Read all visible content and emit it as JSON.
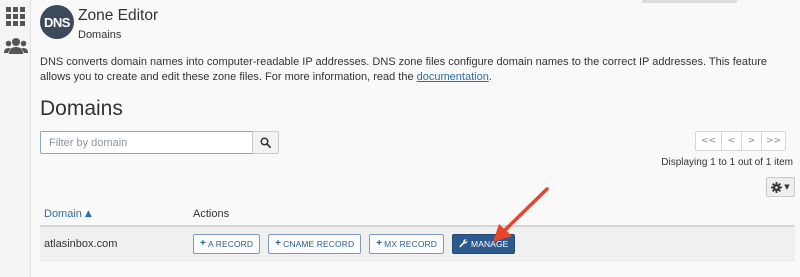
{
  "app": {
    "logo_text": "DNS",
    "title": "Zone Editor",
    "breadcrumb": "Domains"
  },
  "intro": {
    "text": "DNS converts domain names into computer-readable IP addresses. DNS zone files configure domain names to the correct IP addresses. This feature allows you to create and edit these zone files. For more information, read the ",
    "link_label": "documentation",
    "trailing": "."
  },
  "section": {
    "title": "Domains"
  },
  "filter": {
    "placeholder": "Filter by domain",
    "value": ""
  },
  "pager": {
    "first": "<<",
    "prev": "<",
    "next": ">",
    "last": ">>"
  },
  "paging_info": "Displaying 1 to 1 out of 1 item",
  "table": {
    "col_domain": "Domain",
    "col_actions": "Actions",
    "rows": [
      {
        "domain": "atlasinbox.com",
        "a_record": "A RECORD",
        "cname_record": "CNAME RECORD",
        "mx_record": "MX RECORD",
        "manage": "MANAGE"
      }
    ]
  },
  "icons": {
    "rail": [
      "apps-grid-icon",
      "users-icon"
    ],
    "filter": "search-icon",
    "settings": "gear-icon",
    "sort": "sort-ascending-icon",
    "manage": "wrench-icon",
    "add": "plus-icon"
  },
  "colors": {
    "accent": "#2e6ea6",
    "primary_button": "#2d5a8e",
    "annotation_arrow": "#e8452c"
  }
}
